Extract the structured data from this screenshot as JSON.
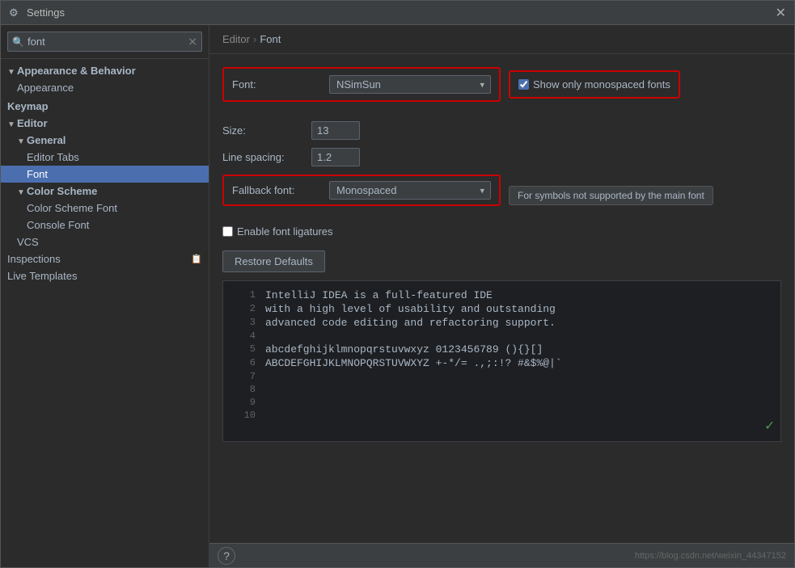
{
  "window": {
    "title": "Settings",
    "icon": "⚙"
  },
  "search": {
    "value": "font",
    "placeholder": "font"
  },
  "sidebar": {
    "items": [
      {
        "id": "appearance-behavior",
        "label": "▼ Appearance & Behavior",
        "indent": 0,
        "type": "header",
        "selected": false
      },
      {
        "id": "appearance",
        "label": "Appearance",
        "indent": 1,
        "selected": false
      },
      {
        "id": "keymap",
        "label": "Keymap",
        "indent": 0,
        "type": "section",
        "selected": false
      },
      {
        "id": "editor",
        "label": "▼ Editor",
        "indent": 0,
        "type": "header",
        "selected": false
      },
      {
        "id": "general",
        "label": "▼ General",
        "indent": 1,
        "type": "header",
        "selected": false
      },
      {
        "id": "editor-tabs",
        "label": "Editor Tabs",
        "indent": 2,
        "selected": false
      },
      {
        "id": "font",
        "label": "Font",
        "indent": 2,
        "selected": true
      },
      {
        "id": "color-scheme",
        "label": "▼ Color Scheme",
        "indent": 1,
        "type": "header",
        "selected": false
      },
      {
        "id": "color-scheme-font",
        "label": "Color Scheme Font",
        "indent": 2,
        "selected": false
      },
      {
        "id": "console-font",
        "label": "Console Font",
        "indent": 2,
        "selected": false
      },
      {
        "id": "vcs",
        "label": "VCS",
        "indent": 1,
        "selected": false
      },
      {
        "id": "inspections",
        "label": "Inspections",
        "indent": 0,
        "selected": false
      },
      {
        "id": "live-templates",
        "label": "Live Templates",
        "indent": 0,
        "selected": false
      }
    ]
  },
  "breadcrumb": {
    "parent": "Editor",
    "separator": "›",
    "current": "Font"
  },
  "font_settings": {
    "font_label": "Font:",
    "font_value": "NSimSun",
    "show_monospaced_label": "Show only monospaced fonts",
    "show_monospaced_checked": true,
    "size_label": "Size:",
    "size_value": "13",
    "line_spacing_label": "Line spacing:",
    "line_spacing_value": "1.2",
    "fallback_label": "Fallback font:",
    "fallback_value": "Monospaced",
    "fallback_tooltip": "For symbols not supported by the main font",
    "ligatures_label": "Enable font ligatures",
    "ligatures_checked": false,
    "restore_label": "Restore Defaults"
  },
  "preview": {
    "lines": [
      {
        "num": "1",
        "code": "IntelliJ IDEA is a full-featured IDE"
      },
      {
        "num": "2",
        "code": "with a high level of usability and outstanding"
      },
      {
        "num": "3",
        "code": "advanced code editing and refactoring support."
      },
      {
        "num": "4",
        "code": ""
      },
      {
        "num": "5",
        "code": "abcdefghijklmnopqrstuvwxyz 0123456789 (){}[]"
      },
      {
        "num": "6",
        "code": "ABCDEFGHIJKLMNOPQRSTUVWXYZ +-*/= .,;:!? #&$%@|`"
      },
      {
        "num": "7",
        "code": ""
      },
      {
        "num": "8",
        "code": ""
      },
      {
        "num": "9",
        "code": ""
      },
      {
        "num": "10",
        "code": ""
      }
    ]
  },
  "bottom": {
    "help": "?",
    "watermark": "https://blog.csdn.net/weixin_44347152"
  }
}
